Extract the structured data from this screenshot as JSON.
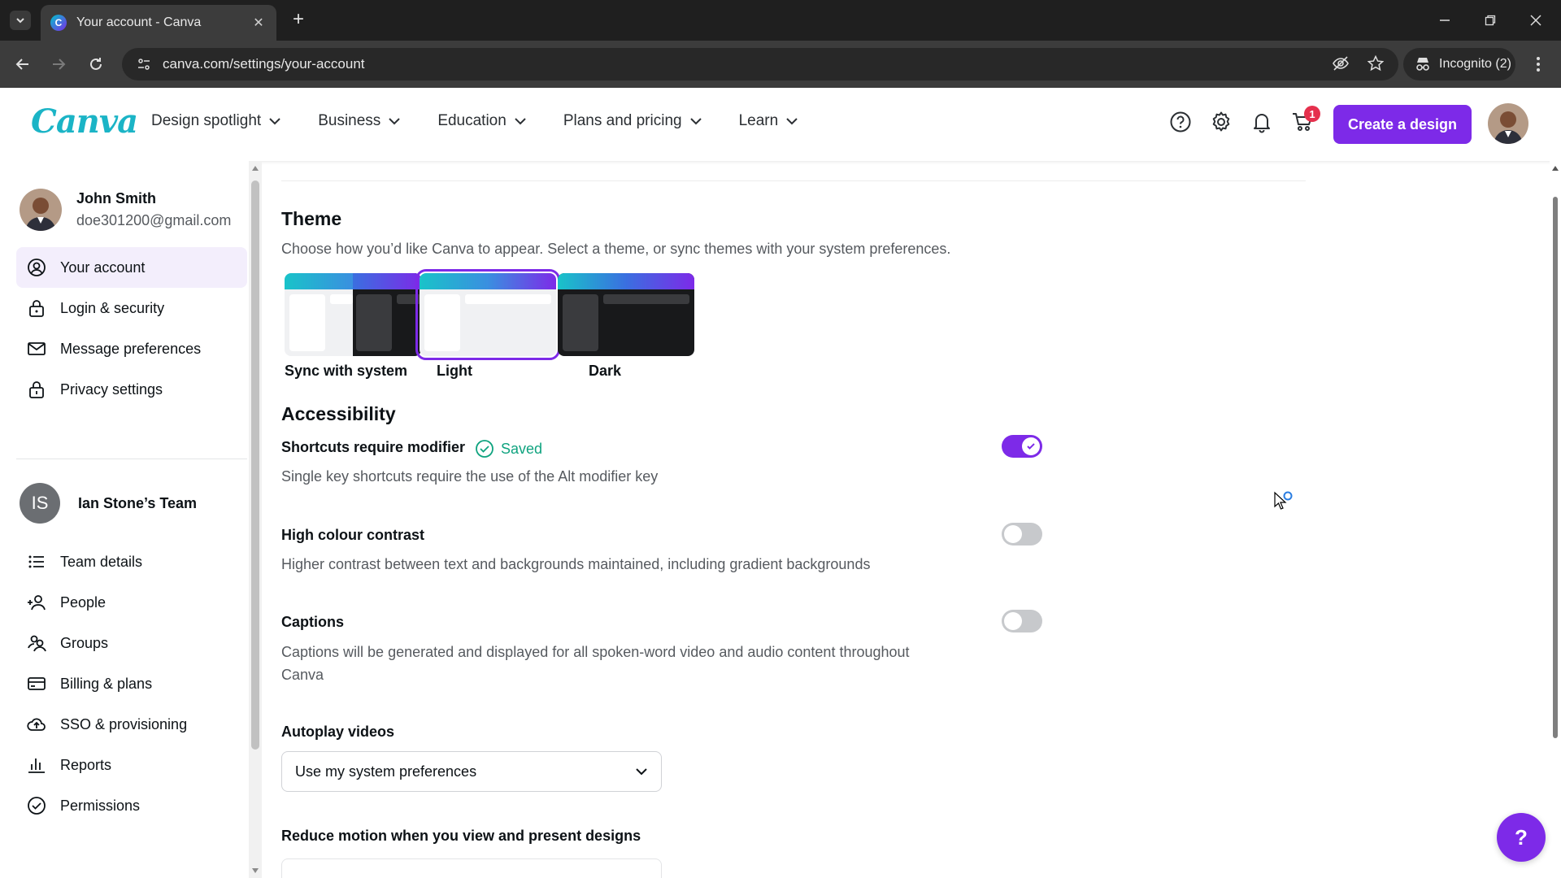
{
  "browser": {
    "tab_title": "Your account - Canva",
    "url": "canva.com/settings/your-account",
    "incognito_label": "Incognito (2)"
  },
  "header": {
    "logo_text": "Canva",
    "nav": [
      "Design spotlight",
      "Business",
      "Education",
      "Plans and pricing",
      "Learn"
    ],
    "cart_count": "1",
    "create_button": "Create a design"
  },
  "sidebar": {
    "user": {
      "name": "John Smith",
      "email": "doe301200@gmail.com"
    },
    "account_items": [
      "Your account",
      "Login & security",
      "Message preferences",
      "Privacy settings"
    ],
    "team": {
      "initials": "IS",
      "name": "Ian Stone’s Team"
    },
    "team_items": [
      "Team details",
      "People",
      "Groups",
      "Billing & plans",
      "SSO & provisioning",
      "Reports",
      "Permissions"
    ]
  },
  "theme": {
    "title": "Theme",
    "description": "Choose how you’d like Canva to appear. Select a theme, or sync themes with your system preferences.",
    "options": [
      "Sync with system",
      "Light",
      "Dark"
    ],
    "selected": "Light"
  },
  "accessibility": {
    "title": "Accessibility",
    "shortcuts": {
      "label": "Shortcuts require modifier",
      "saved": "Saved",
      "description": "Single key shortcuts require the use of the Alt modifier key",
      "enabled": true
    },
    "contrast": {
      "label": "High colour contrast",
      "description": "Higher contrast between text and backgrounds maintained, including gradient backgrounds",
      "enabled": false
    },
    "captions": {
      "label": "Captions",
      "description_line1": "Captions will be generated and displayed for all spoken-word video and audio content throughout",
      "description_line2": "Canva",
      "enabled": false
    },
    "autoplay": {
      "label": "Autoplay videos",
      "value": "Use my system preferences"
    },
    "reduce_motion": {
      "label": "Reduce motion when you view and present designs"
    }
  },
  "help_fab": "?",
  "colors": {
    "accent": "#7d2ae8",
    "saved": "#0fa37f",
    "badge": "#e5304d"
  }
}
